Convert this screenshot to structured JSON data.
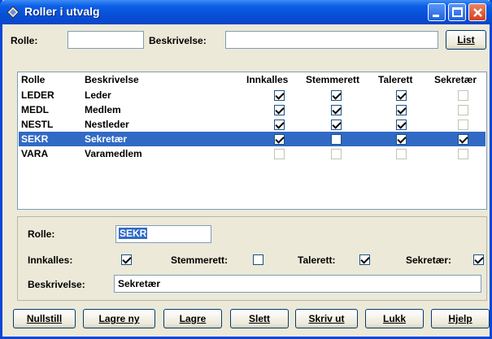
{
  "window": {
    "title": "Roller i utvalg"
  },
  "filter": {
    "rolle_label": "Rolle:",
    "rolle_value": "",
    "beskrivelse_label": "Beskrivelse:",
    "beskrivelse_value": "",
    "list_button": "List"
  },
  "grid": {
    "headers": [
      "Rolle",
      "Beskrivelse",
      "Innkalles",
      "Stemmerett",
      "Talerett",
      "Sekretær"
    ],
    "rows": [
      {
        "rolle": "LEDER",
        "beskrivelse": "Leder",
        "innkalles": true,
        "stemmerett": true,
        "talerett": true,
        "sekretaer": false,
        "selected": false
      },
      {
        "rolle": "MEDL",
        "beskrivelse": "Medlem",
        "innkalles": true,
        "stemmerett": true,
        "talerett": true,
        "sekretaer": false,
        "selected": false
      },
      {
        "rolle": "NESTL",
        "beskrivelse": "Nestleder",
        "innkalles": true,
        "stemmerett": true,
        "talerett": true,
        "sekretaer": false,
        "selected": false
      },
      {
        "rolle": "SEKR",
        "beskrivelse": "Sekretær",
        "innkalles": true,
        "stemmerett": false,
        "talerett": true,
        "sekretaer": true,
        "selected": true
      },
      {
        "rolle": "VARA",
        "beskrivelse": "Varamedlem",
        "innkalles": false,
        "stemmerett": false,
        "talerett": false,
        "sekretaer": false,
        "selected": false
      }
    ]
  },
  "detail": {
    "rolle_label": "Rolle:",
    "rolle_value": "SEKR",
    "innkalles_label": "Innkalles:",
    "innkalles": true,
    "stemmerett_label": "Stemmerett:",
    "stemmerett": false,
    "talerett_label": "Talerett:",
    "talerett": true,
    "sekretaer_label": "Sekretær:",
    "sekretaer": true,
    "beskrivelse_label": "Beskrivelse:",
    "beskrivelse_value": "Sekretær"
  },
  "buttons": {
    "nullstill": "Nullstill",
    "lagre_ny": "Lagre ny",
    "lagre": "Lagre",
    "slett": "Slett",
    "skriv_ut": "Skriv ut",
    "lukk": "Lukk",
    "hjelp": "Hjelp"
  }
}
